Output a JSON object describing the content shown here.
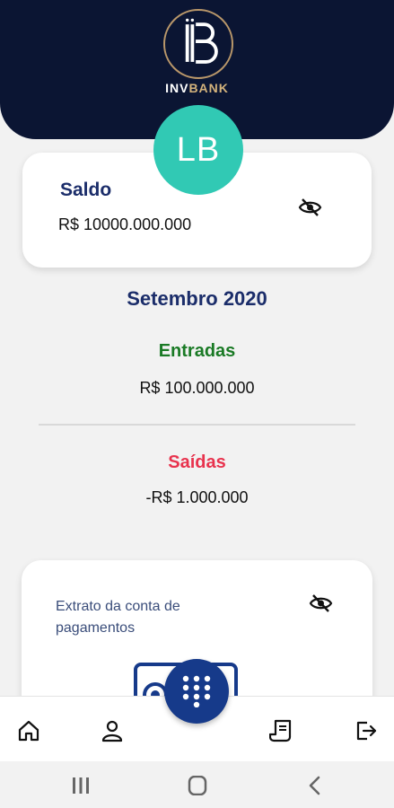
{
  "header": {
    "brand_part1": "INV",
    "brand_part2": "BANK",
    "colors": {
      "background": "#0b1533",
      "gold": "#d4b37c"
    }
  },
  "avatar": {
    "initials": "LB",
    "color": "#31c9b4"
  },
  "balance": {
    "title": "Saldo",
    "value": "R$ 10000.000.000",
    "toggle_icon": "eye-off-icon"
  },
  "summary": {
    "month": "Setembro 2020",
    "income_label": "Entradas",
    "income_value": "R$ 100.000.000",
    "outcome_label": "Saídas",
    "outcome_value": "-R$ 1.000.000",
    "colors": {
      "income": "#1a7a25",
      "outcome": "#e8334e",
      "title": "#1b2d6a"
    }
  },
  "statement": {
    "text": "Extrato da conta de pagamentos",
    "toggle_icon": "eye-off-icon"
  },
  "bottom_nav": {
    "items": [
      "home-icon",
      "profile-icon",
      "keypad-icon",
      "receipt-icon",
      "logout-icon"
    ]
  },
  "system_nav": {
    "items": [
      "recents-icon",
      "home-circle-icon",
      "back-icon"
    ]
  }
}
